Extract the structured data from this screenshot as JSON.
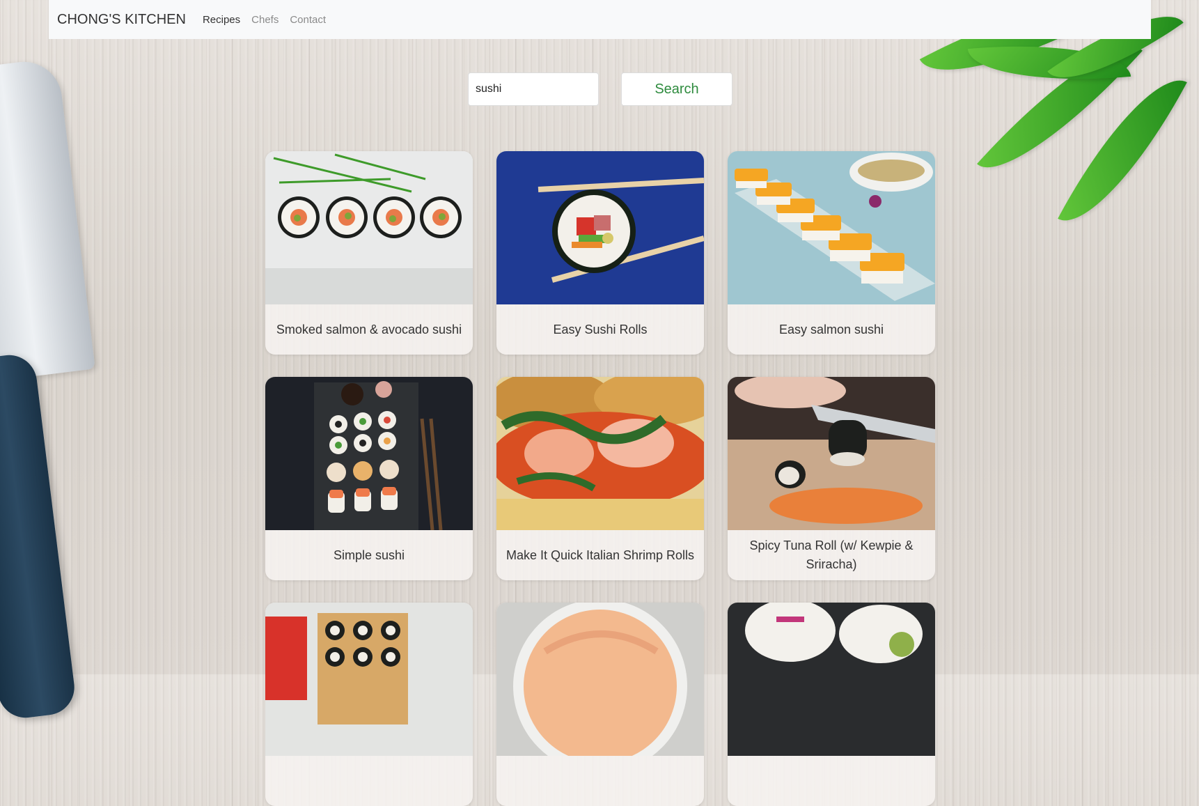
{
  "navbar": {
    "brand": "CHONG'S KITCHEN",
    "links": [
      "Recipes",
      "Chefs",
      "Contact"
    ],
    "active_link": "Recipes"
  },
  "search": {
    "value": "sushi",
    "button_label": "Search"
  },
  "recipes": [
    {
      "title": "Smoked salmon & avocado sushi"
    },
    {
      "title": "Easy Sushi Rolls"
    },
    {
      "title": "Easy salmon sushi"
    },
    {
      "title": "Simple sushi"
    },
    {
      "title": "Make It Quick Italian Shrimp Rolls"
    },
    {
      "title": "Spicy Tuna Roll (w/ Kewpie & Sriracha)"
    },
    {
      "title": ""
    },
    {
      "title": ""
    },
    {
      "title": ""
    }
  ],
  "colors": {
    "navbar_bg": "#f8f9fa",
    "search_button_text": "#2e8b3e",
    "card_bg": "#f6f3f0"
  }
}
